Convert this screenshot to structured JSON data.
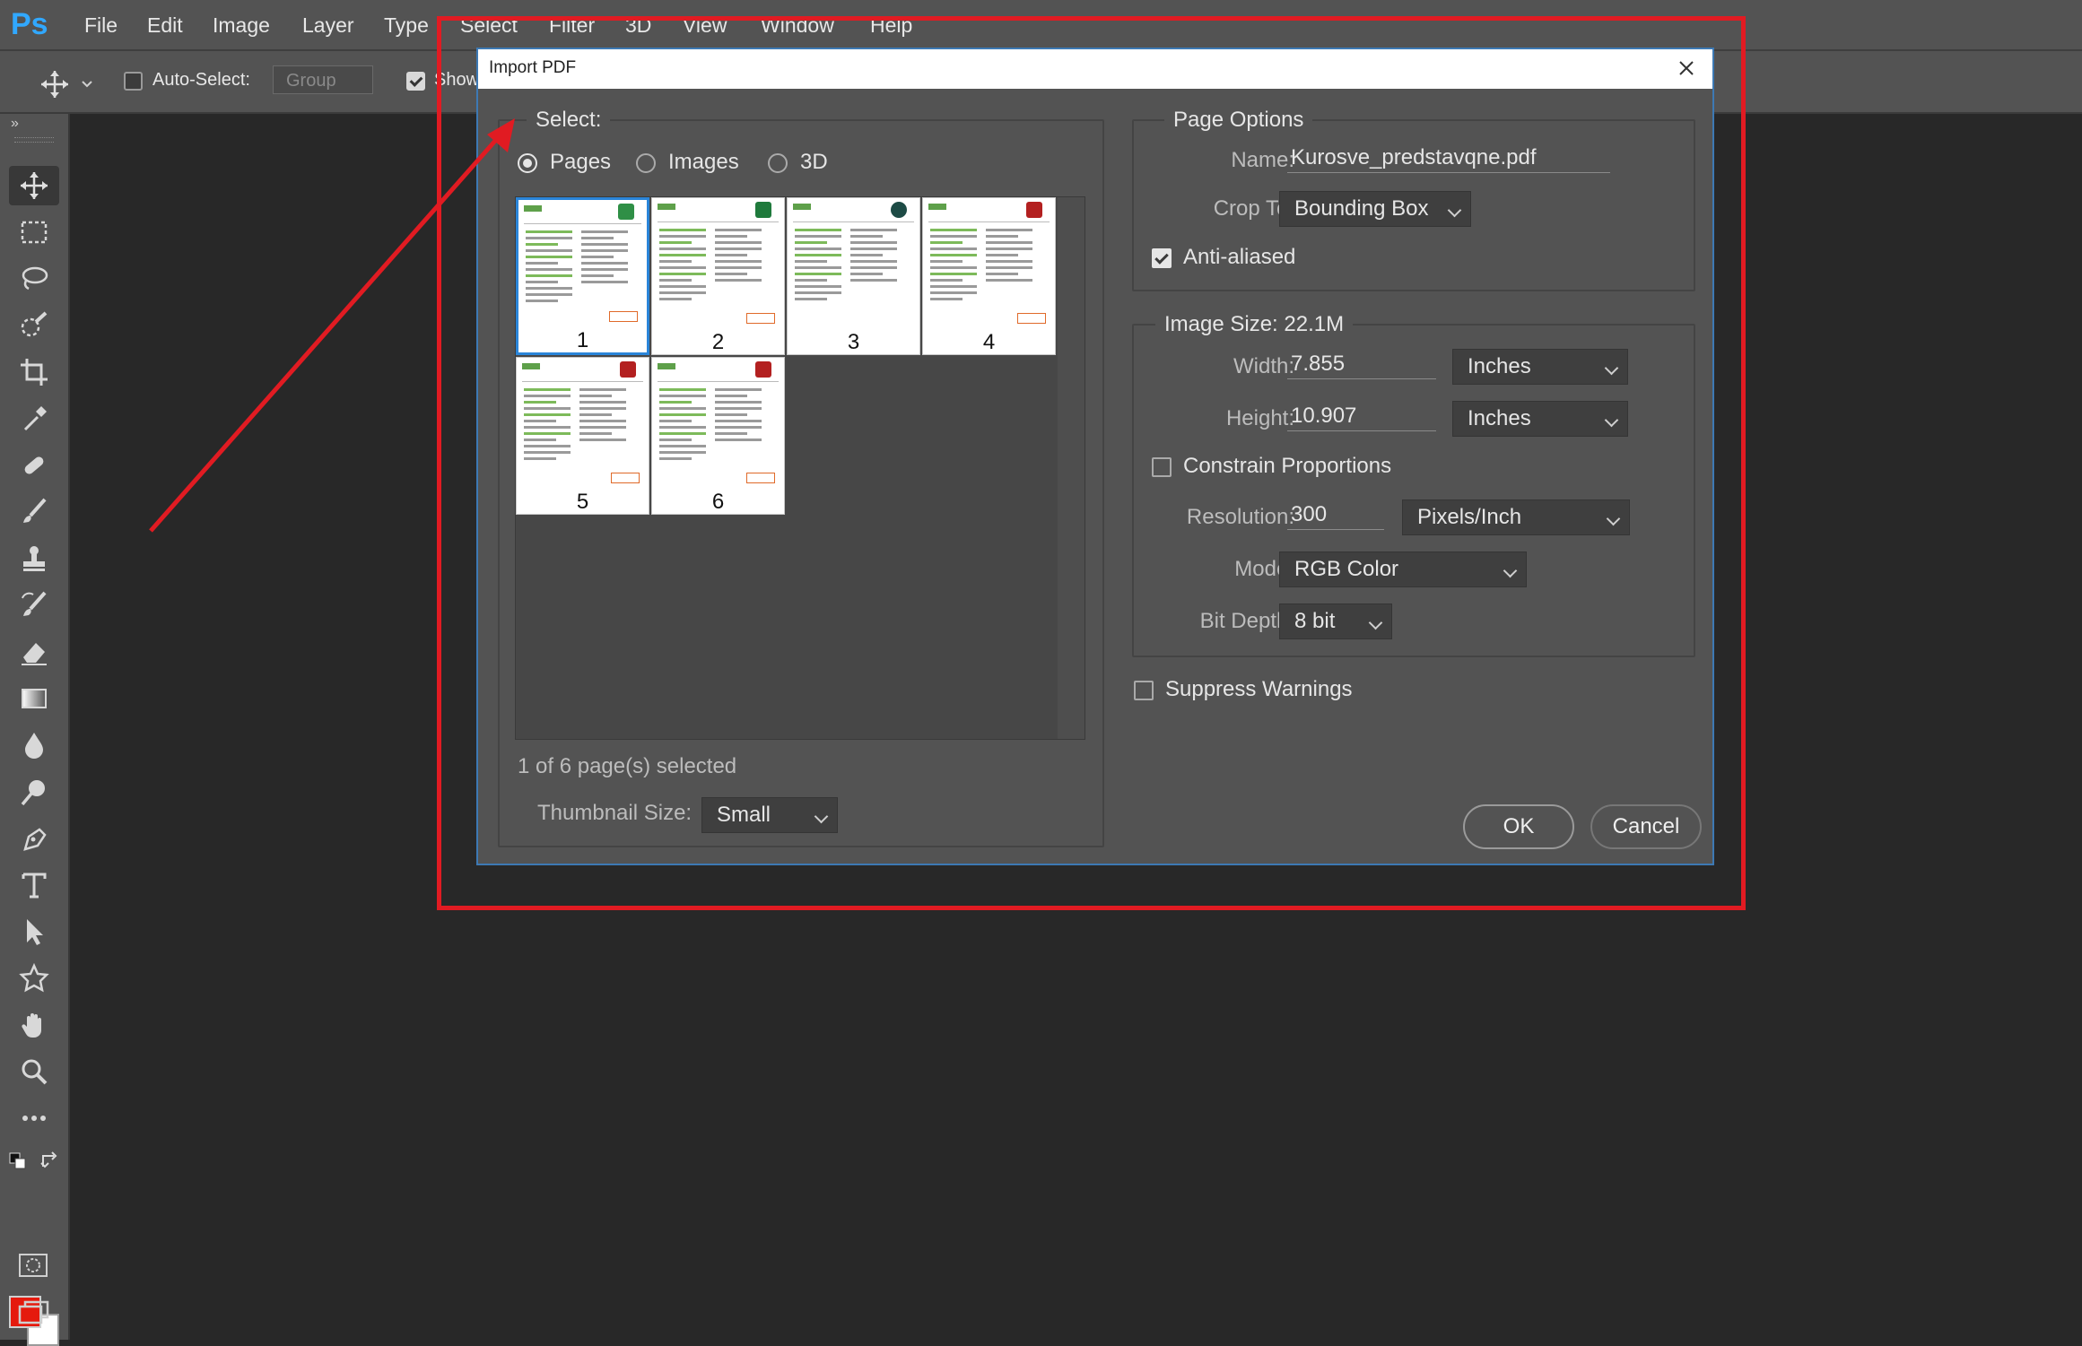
{
  "app": {
    "logo": "Ps"
  },
  "menu": [
    "File",
    "Edit",
    "Image",
    "Layer",
    "Type",
    "Select",
    "Filter",
    "3D",
    "View",
    "Window",
    "Help"
  ],
  "options_bar": {
    "tool_icon": "move-icon",
    "auto_select_label": "Auto-Select:",
    "auto_select_checked": false,
    "group_select_value": "Group",
    "show_label": "Show"
  },
  "tools": [
    "move-icon",
    "marquee-icon",
    "lasso-icon",
    "quick-select-icon",
    "crop-icon",
    "eyedropper-icon",
    "healing-brush-icon",
    "brush-icon",
    "clone-stamp-icon",
    "history-brush-icon",
    "eraser-icon",
    "gradient-icon",
    "blur-icon",
    "dodge-icon",
    "pen-icon",
    "type-icon",
    "path-select-icon",
    "shape-icon",
    "hand-icon",
    "zoom-icon",
    "more-tools-icon"
  ],
  "colors": {
    "foreground": "#e51a0e",
    "background": "#ffffff",
    "highlight": "#e11b22"
  },
  "dialog": {
    "title": "Import PDF",
    "select": {
      "legend": "Select:",
      "options": [
        "Pages",
        "Images",
        "3D"
      ],
      "selected": "Pages",
      "thumbnails": [
        "1",
        "2",
        "3",
        "4",
        "5",
        "6"
      ],
      "selected_page": "1",
      "status": "1 of 6 page(s) selected",
      "thumbnail_size_label": "Thumbnail Size:",
      "thumbnail_size_value": "Small"
    },
    "page_options": {
      "legend": "Page Options",
      "name_label": "Name:",
      "name_value": "Kurosve_predstavqne.pdf",
      "crop_label": "Crop To:",
      "crop_value": "Bounding Box",
      "anti_aliased_label": "Anti-aliased",
      "anti_aliased_checked": true
    },
    "image_size": {
      "legend": "Image Size: 22.1M",
      "width_label": "Width:",
      "width_value": "7.855",
      "width_unit": "Inches",
      "height_label": "Height:",
      "height_value": "10.907",
      "height_unit": "Inches",
      "constrain_label": "Constrain Proportions",
      "constrain_checked": false,
      "resolution_label": "Resolution:",
      "resolution_value": "300",
      "resolution_unit": "Pixels/Inch",
      "mode_label": "Mode:",
      "mode_value": "RGB Color",
      "bit_depth_label": "Bit Depth:",
      "bit_depth_value": "8 bit"
    },
    "suppress_warnings_label": "Suppress Warnings",
    "suppress_warnings_checked": false,
    "ok_label": "OK",
    "cancel_label": "Cancel"
  }
}
